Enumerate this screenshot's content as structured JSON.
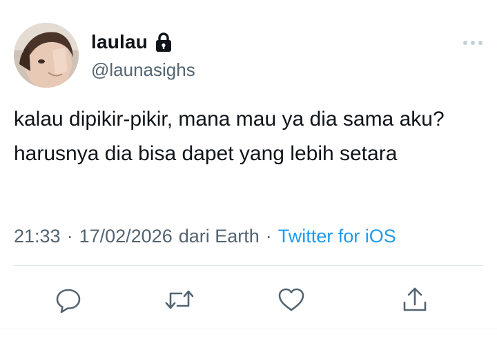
{
  "tweet": {
    "author": {
      "display_name": "laulau",
      "handle": "@launasighs",
      "protected_icon": "lock-icon",
      "avatar": "profile-photo"
    },
    "text": "kalau dipikir-pikir, mana mau ya dia sama aku? harusnya dia bisa dapet yang lebih setara",
    "meta": {
      "time": "21:33",
      "separator": "·",
      "date": "17/02/2026",
      "location": "dari Earth",
      "client": "Twitter for iOS"
    },
    "actions": [
      {
        "name": "reply",
        "icon": "reply-icon"
      },
      {
        "name": "retweet",
        "icon": "retweet-icon"
      },
      {
        "name": "like",
        "icon": "heart-icon"
      },
      {
        "name": "share",
        "icon": "share-icon"
      }
    ],
    "menu_icon": "more-icon"
  },
  "colors": {
    "text_primary": "#0f1419",
    "text_secondary": "#536471",
    "link": "#1d9bf0",
    "divider": "#e1e6ea"
  }
}
